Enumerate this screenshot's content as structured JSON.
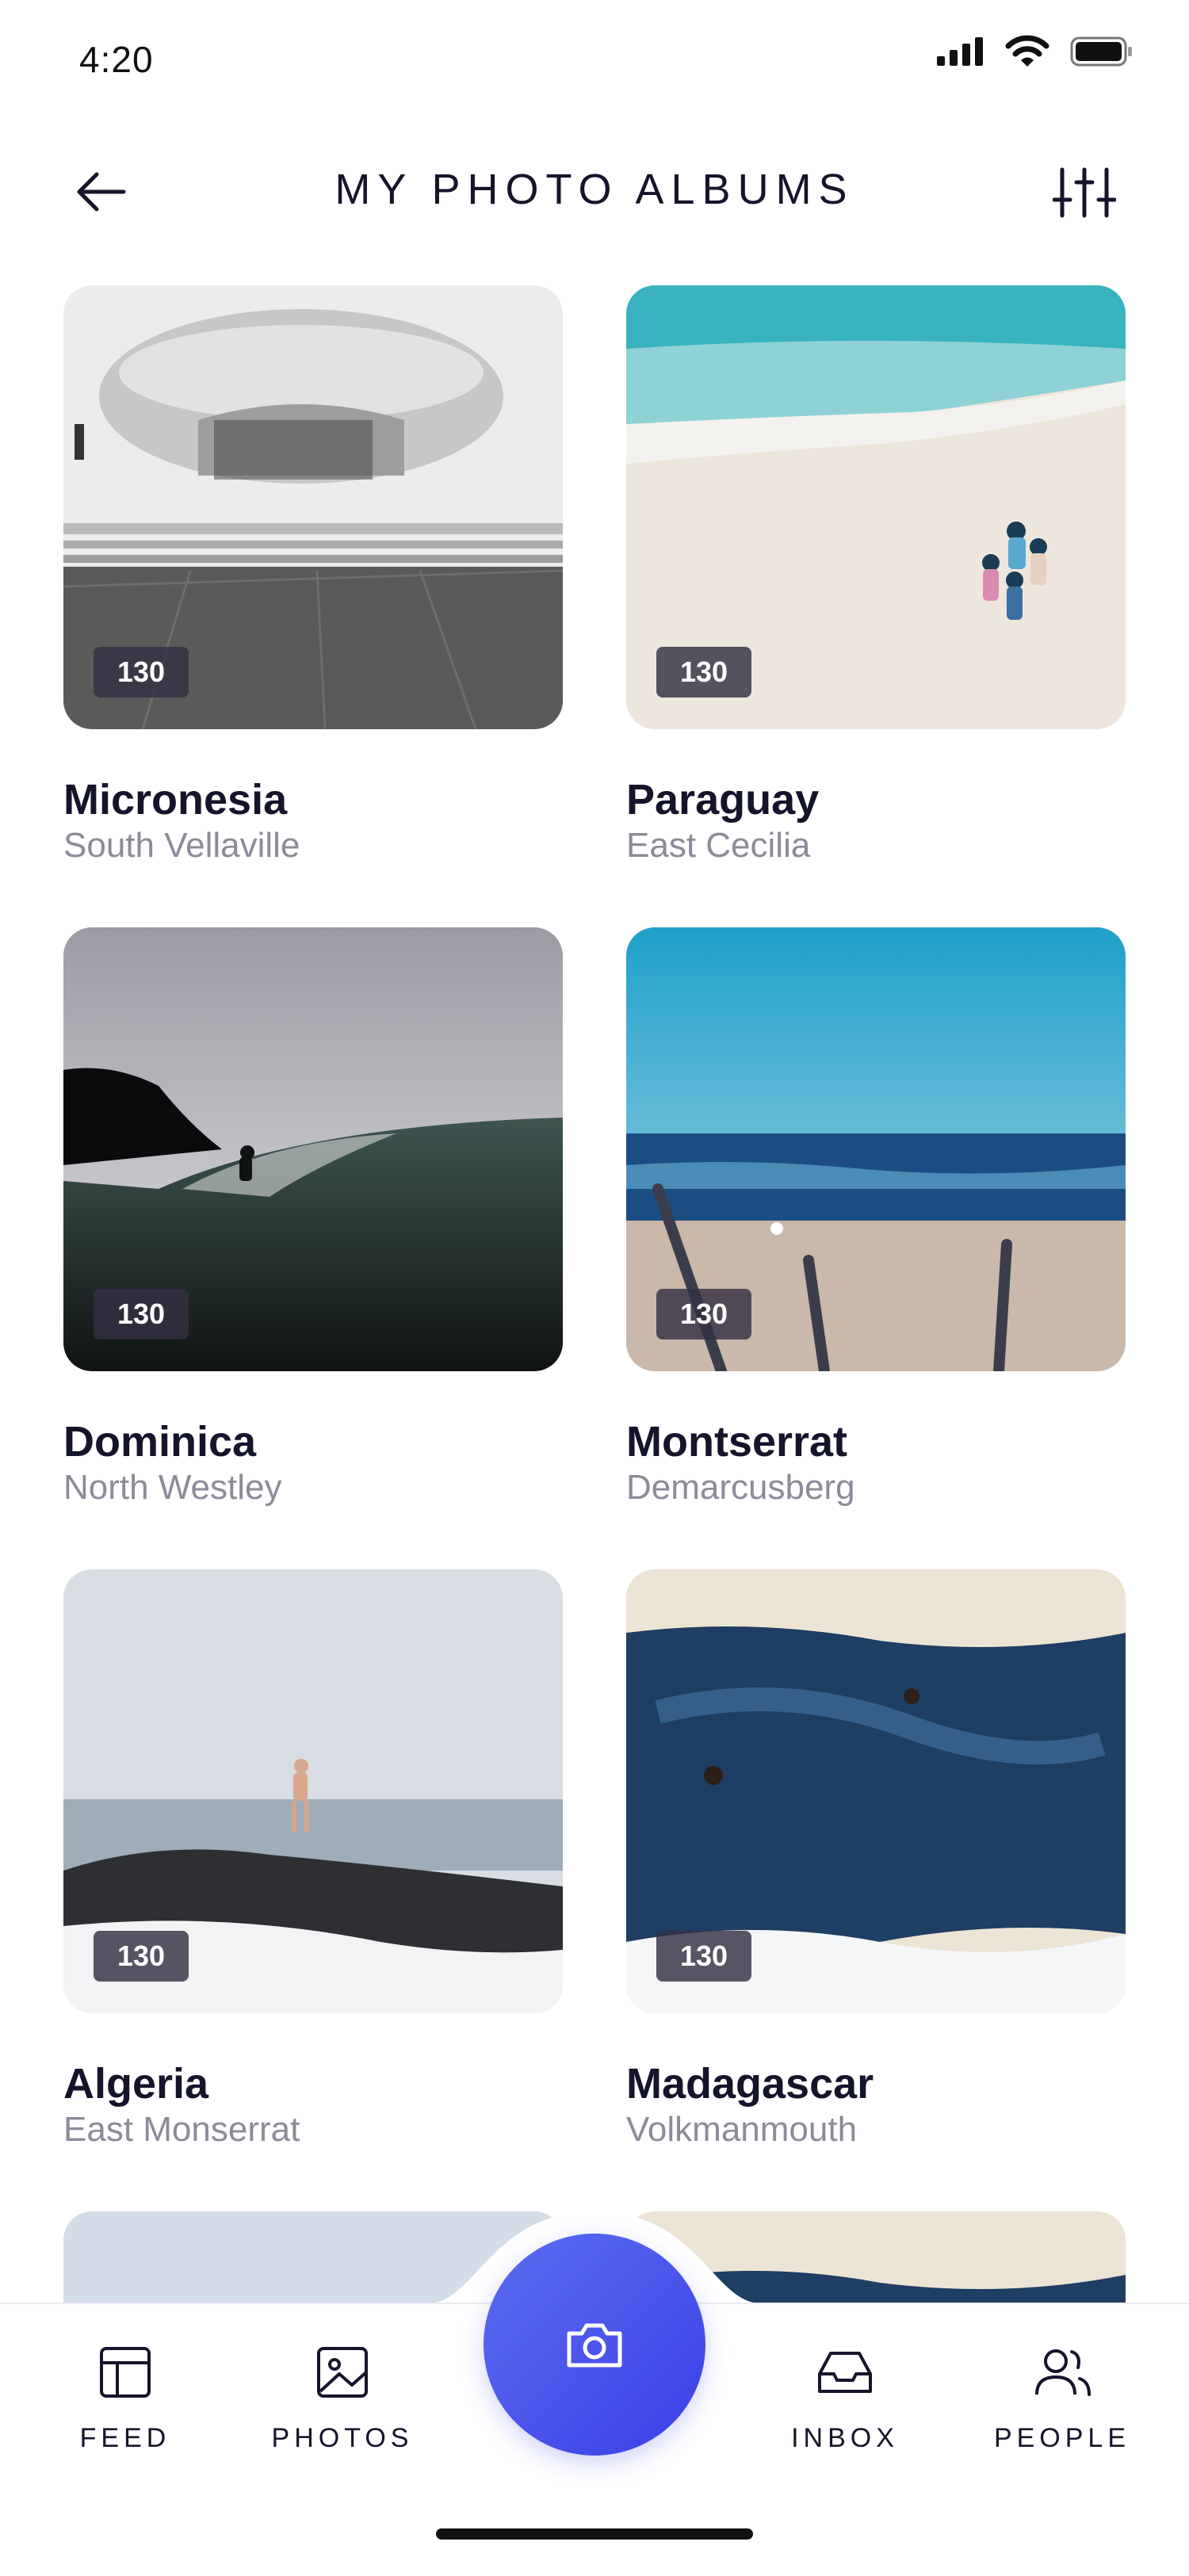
{
  "status_bar": {
    "time": "4:20"
  },
  "header": {
    "title": "MY PHOTO ALBUMS"
  },
  "albums": [
    {
      "name": "Micronesia",
      "location": "South Vellaville",
      "count": "130"
    },
    {
      "name": "Paraguay",
      "location": "East Cecilia",
      "count": "130"
    },
    {
      "name": "Dominica",
      "location": "North Westley",
      "count": "130"
    },
    {
      "name": "Montserrat",
      "location": "Demarcusberg",
      "count": "130"
    },
    {
      "name": "Algeria",
      "location": "East Monserrat",
      "count": "130"
    },
    {
      "name": "Madagascar",
      "location": "Volkmanmouth",
      "count": "130"
    }
  ],
  "nav": {
    "feed": "FEED",
    "photos": "PHOTOS",
    "inbox": "INBOX",
    "people": "PEOPLE"
  },
  "icons": {
    "back": "arrow-left-icon",
    "filter": "sliders-icon",
    "camera": "camera-icon",
    "feed": "layout-icon",
    "photos": "image-icon",
    "inbox": "inbox-icon",
    "people": "users-icon"
  },
  "colors": {
    "accent": "#4a4fe8",
    "text": "#14142b",
    "muted": "#8b8b99"
  }
}
